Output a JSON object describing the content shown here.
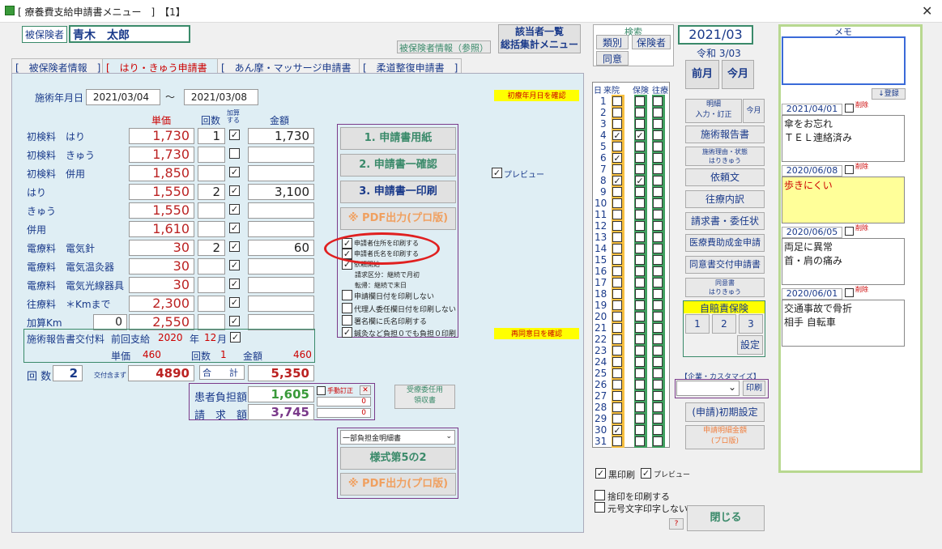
{
  "window": {
    "title": "[ 療養費支給申請書メニュー　]　【1】",
    "close": "✕"
  },
  "header": {
    "insured_label": "被保険者",
    "insured_name": "青木　太郎",
    "insured_ref": "被保険者情報（参照）",
    "list_btn1": "該当者一覧",
    "list_btn2": "総括集計メニュー",
    "search_label": "検索",
    "search_btns": [
      "類別",
      "保険者",
      "同意"
    ],
    "year_month": "2021/03",
    "wareki": "令和 3/03",
    "prev_month": "前月",
    "this_month": "今月"
  },
  "tabs": [
    "[　被保険者情報　]",
    "[　はり・きゅう申請書　]",
    "[　あん摩・マッサージ申請書　]",
    "[　柔道整復申請書　]"
  ],
  "period": {
    "label": "施術年月日",
    "from": "2021/03/04",
    "sep": "〜",
    "to": "2021/03/08",
    "note1": "初療年月日を確認",
    "note2": "再同意日を確認"
  },
  "cols": {
    "unit": "単価",
    "count": "回数",
    "chk": "加算する",
    "amount": "金額"
  },
  "rows": [
    {
      "label": "初検料　はり",
      "unit": "1,730",
      "count": "1",
      "chk": true,
      "amount": "1,730"
    },
    {
      "label": "初検料　きゅう",
      "unit": "1,730",
      "count": "",
      "chk": false,
      "amount": ""
    },
    {
      "label": "初検料　併用",
      "unit": "1,850",
      "count": "",
      "chk": true,
      "amount": ""
    },
    {
      "label": "はり",
      "unit": "1,550",
      "count": "2",
      "chk": true,
      "amount": "3,100"
    },
    {
      "label": "きゅう",
      "unit": "1,550",
      "count": "",
      "chk": true,
      "amount": ""
    },
    {
      "label": "併用",
      "unit": "1,610",
      "count": "",
      "chk": true,
      "amount": ""
    },
    {
      "label": "電療料　電気針",
      "unit": "30",
      "count": "2",
      "chk": true,
      "amount": "60"
    },
    {
      "label": "電療料　電気温灸器",
      "unit": "30",
      "count": "",
      "chk": true,
      "amount": ""
    },
    {
      "label": "電療料　電気光線器具",
      "unit": "30",
      "count": "",
      "chk": true,
      "amount": ""
    },
    {
      "label": "往療料　＊Kmまで",
      "unit": "2,300",
      "count": "",
      "chk": true,
      "amount": ""
    },
    {
      "label": "加算Km",
      "unit": "2,550",
      "count": "",
      "chk": true,
      "amount": "",
      "km": "0"
    }
  ],
  "report": {
    "label": "施術報告書交付料",
    "prev": "前回支給",
    "year": "2020",
    "yl": "年",
    "month": "12",
    "ml": "月",
    "unit_l": "単価",
    "unit": "460",
    "cnt_l": "回数",
    "cnt": "1",
    "amt_l": "金額",
    "amt": "460"
  },
  "totals": {
    "kai_label": "回 数",
    "kai": "2",
    "deliver_label": "交付含まず",
    "deliver": "4890",
    "sum_label": "合　　計",
    "sum": "5,350",
    "patient_label": "患者負担額",
    "patient": "1,605",
    "manual": "手動訂正",
    "claim_label": "請　求　額",
    "claim": "3,745",
    "zero1": "0",
    "zero2": "0",
    "proxy": "受療委任用\n領収書"
  },
  "print_buttons": [
    "1. 申請書用紙",
    "2. 申請書一確認",
    "3. 申請書一印刷",
    "※ PDF出力(プロ版)"
  ],
  "options": [
    "申請者住所を印刷する",
    "申請者氏名を印刷する",
    "依頼開始",
    "請求区分：継続で月初",
    "転帰：継続で末日",
    "申請欄日付を印刷しない",
    "代理人委任欄日付を印刷しない",
    "署名欄に氏名印刷する",
    "鍼灸など負担０でも負担０印刷"
  ],
  "preview": "プレビュー",
  "detail": {
    "select": "一部負担金明細書",
    "btn": "様式第5の2",
    "pdf": "※ PDF出力(プロ版)"
  },
  "days": {
    "hdr_day": "日",
    "hdr_visit": "来院",
    "hdr_ins": "保険",
    "hdr_ou": "往療",
    "checked_visit": [
      4,
      6,
      8,
      30
    ],
    "checked_ins": [
      4,
      8
    ]
  },
  "right": {
    "meisai": "明細\n入力・訂正",
    "konget": "今月",
    "report": "施術報告書",
    "reason": "施術理由・状態\nはりきゅう",
    "irai": "依頼文",
    "ouryo": "往療内訳",
    "seikyu": "請求書・委任状",
    "iryo": "医療費助成金申請",
    "doui": "同意書交付申請書",
    "doui2": "同意書\nはりきゅう",
    "jibai": "自賠責保険",
    "jibai_btns": [
      "1",
      "2",
      "3"
    ],
    "settei": "設定",
    "custom": "【企業・カスタマイズ】",
    "print": "印刷",
    "init": "(申請)初期設定",
    "meisai2": "申請明細金額\n(プロ版)",
    "kuro": "黒印刷",
    "preview": "プレビュー",
    "sute": "捨印を印刷する",
    "gengo": "元号文字印字しない",
    "help": "?",
    "close": "閉じる"
  },
  "memo": {
    "title": "メモ",
    "reg": "↓登録",
    "del": "削除",
    "entries": [
      {
        "date": "2021/04/01",
        "text": "傘をお忘れ\nＴＥＬ連絡済み",
        "style": "white"
      },
      {
        "date": "2020/06/08",
        "text": "歩きにくい",
        "style": "yellow"
      },
      {
        "date": "2020/06/05",
        "text": "両足に異常\n首・肩の痛み",
        "style": "white"
      },
      {
        "date": "2020/06/01",
        "text": "交通事故で骨折\n相手 自転車",
        "style": "white"
      }
    ]
  }
}
